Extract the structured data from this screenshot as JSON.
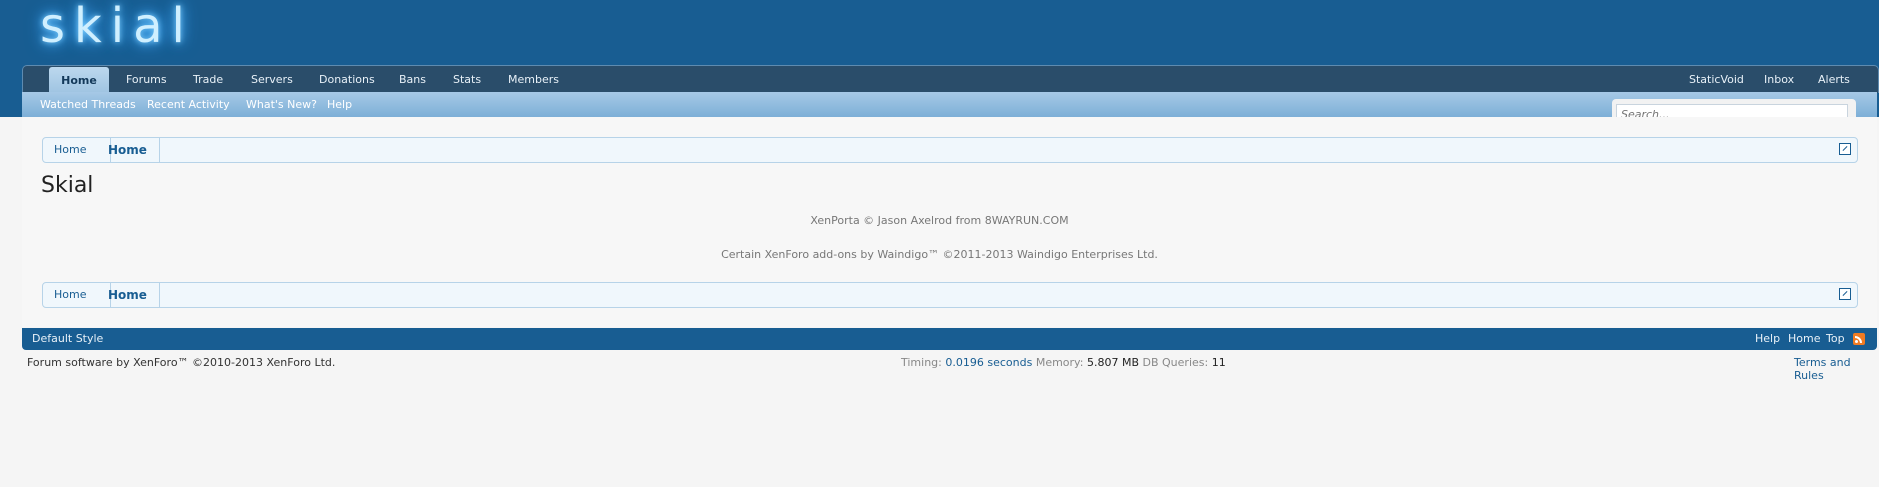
{
  "logo": {
    "text": "skial"
  },
  "nav": {
    "tabs": [
      {
        "label": "Home"
      },
      {
        "label": "Forums"
      },
      {
        "label": "Trade"
      },
      {
        "label": "Servers"
      },
      {
        "label": "Donations"
      },
      {
        "label": "Bans"
      },
      {
        "label": "Stats"
      },
      {
        "label": "Members"
      }
    ],
    "right": [
      {
        "label": "StaticVoid"
      },
      {
        "label": "Inbox"
      },
      {
        "label": "Alerts"
      }
    ]
  },
  "subnav": {
    "links": [
      {
        "label": "Watched Threads"
      },
      {
        "label": "Recent Activity"
      },
      {
        "label": "What's New?"
      },
      {
        "label": "Help"
      }
    ]
  },
  "search": {
    "placeholder": "Search..."
  },
  "breadcrumb": {
    "items": [
      "Home",
      "Home"
    ]
  },
  "page": {
    "title": "Skial",
    "credit1": "XenPorta © Jason Axelrod from 8WAYRUN.COM",
    "credit2": "Certain XenForo add-ons by Waindigo™ ©2011-2013 Waindigo Enterprises Ltd."
  },
  "footer": {
    "style": "Default Style",
    "links": [
      {
        "label": "Help"
      },
      {
        "label": "Home"
      },
      {
        "label": "Top"
      }
    ],
    "copyright": "Forum software by XenForo™ ©2010-2013 XenForo Ltd.",
    "timing_label": "Timing:",
    "timing_value": "0.0196 seconds",
    "memory_label": "Memory:",
    "memory_value": "5.807 MB",
    "queries_label": "DB Queries:",
    "queries_value": "11",
    "terms": "Terms and Rules"
  },
  "colors": {
    "header": "#185d92",
    "navbar": "#2a4d6a",
    "subnav": "#7dafd7",
    "rss": "#f07b22"
  }
}
